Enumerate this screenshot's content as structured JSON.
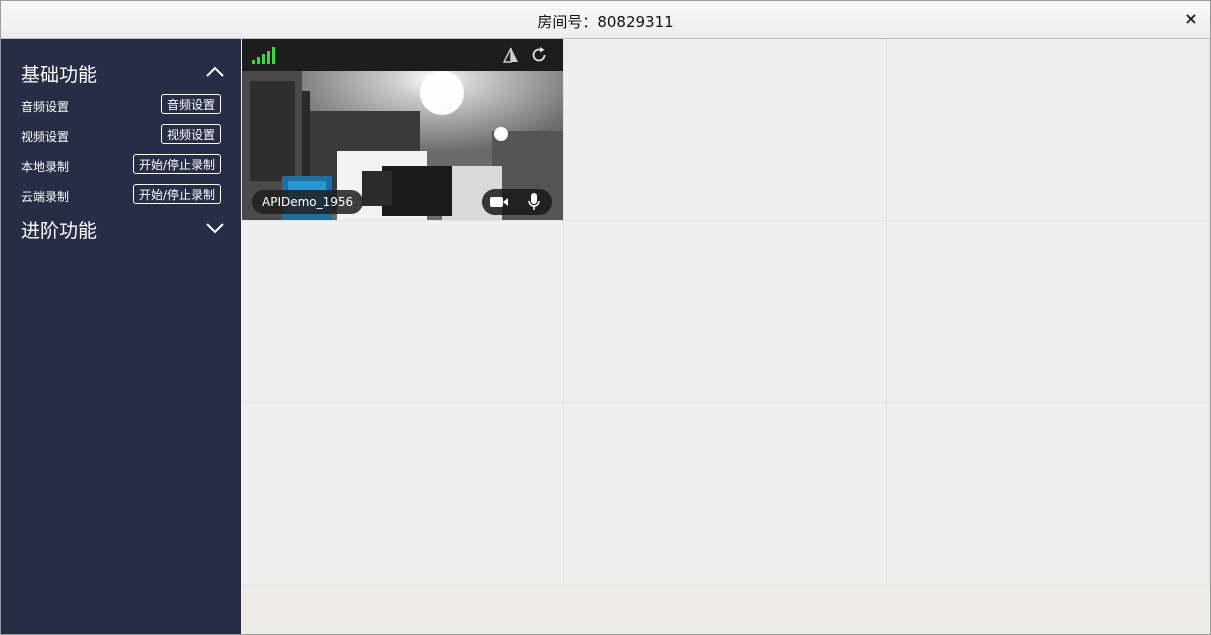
{
  "window": {
    "title": "房间号：80829311",
    "close_glyph": "×"
  },
  "sidebar": {
    "basic": {
      "heading": "基础功能",
      "toggle_icon": "chevron-up-icon",
      "rows": [
        {
          "label": "音频设置",
          "button": "音频设置"
        },
        {
          "label": "视频设置",
          "button": "视频设置"
        },
        {
          "label": "本地录制",
          "button": "开始/停止录制"
        },
        {
          "label": "云端录制",
          "button": "开始/停止录制"
        }
      ]
    },
    "advanced": {
      "heading": "进阶功能",
      "toggle_icon": "chevron-down-icon"
    }
  },
  "video": {
    "user_name": "APIDemo_1956",
    "signal_bars": 5,
    "signal_color": "#3fd63f",
    "icons": [
      "signal-strength-icon",
      "mirror-icon",
      "refresh-icon",
      "camera-icon",
      "microphone-icon"
    ]
  },
  "colors": {
    "sidebar_bg": "#262d45",
    "grid_bg": "#efefef",
    "titlebar_bg": "#f1f1f1"
  }
}
